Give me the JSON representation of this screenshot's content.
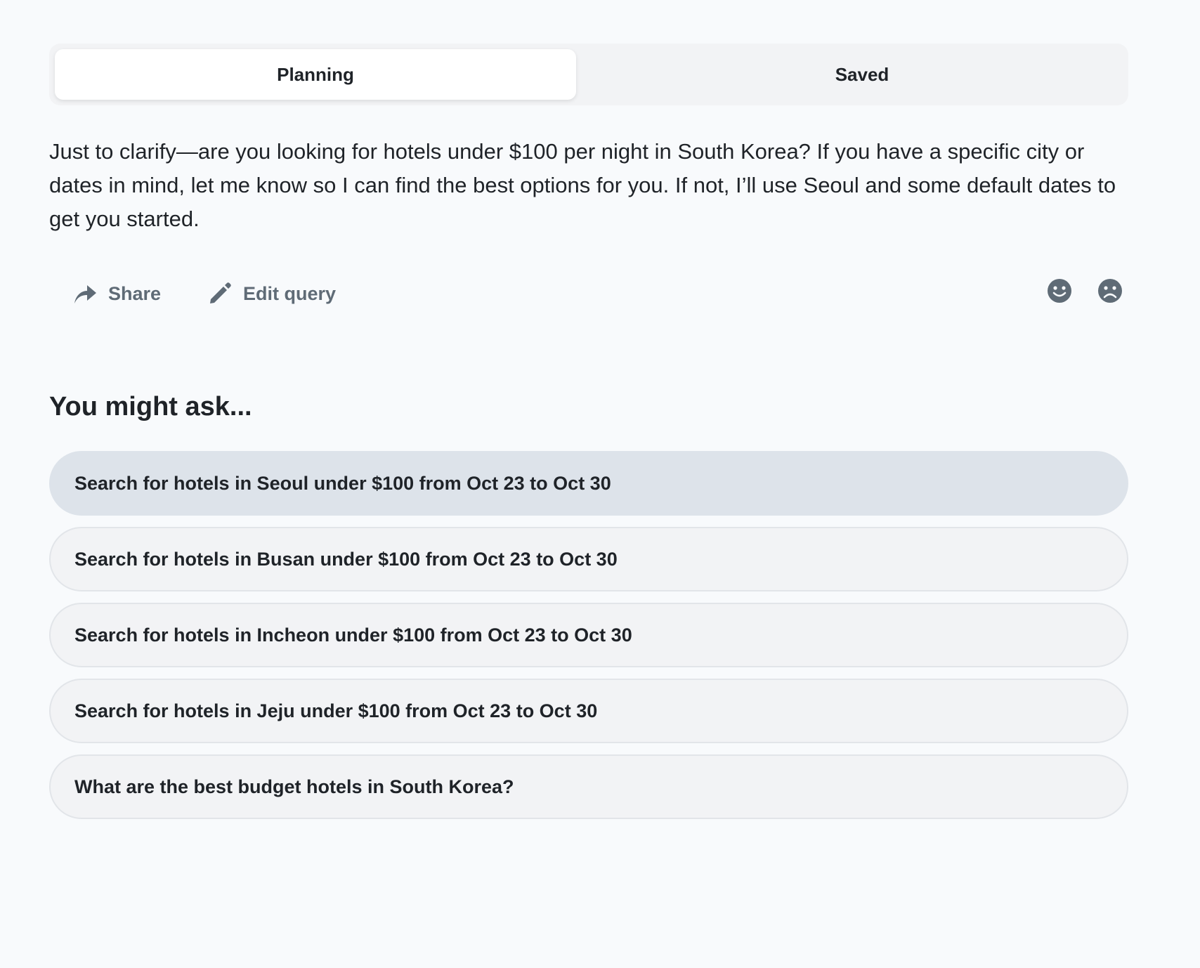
{
  "tabs": [
    {
      "label": "Planning",
      "active": true
    },
    {
      "label": "Saved",
      "active": false
    }
  ],
  "message": {
    "text": "Just to clarify—are you looking for hotels under $100 per night in South Korea? If you have a specific city or dates in mind, let me know so I can find the best options for you. If not, I’ll use Seoul and some default dates to get you started."
  },
  "actions": {
    "share_label": "Share",
    "edit_label": "Edit query",
    "share_icon": "share-arrow-icon",
    "edit_icon": "pencil-icon",
    "thumbs_up_icon": "smile-face-icon",
    "thumbs_down_icon": "frown-face-icon"
  },
  "suggestions": {
    "heading": "You might ask...",
    "items": [
      {
        "label": "Search for hotels in Seoul under $100 from Oct 23 to Oct 30",
        "highlighted": true
      },
      {
        "label": "Search for hotels in Busan under $100 from Oct 23 to Oct 30",
        "highlighted": false
      },
      {
        "label": "Search for hotels in Incheon under $100 from Oct 23 to Oct 30",
        "highlighted": false
      },
      {
        "label": "Search for hotels in Jeju under $100 from Oct 23 to Oct 30",
        "highlighted": false
      },
      {
        "label": "What are the best budget hotels in South Korea?",
        "highlighted": false
      }
    ]
  },
  "colors": {
    "background": "#f8fafc",
    "text": "#1f2328",
    "muted": "#5f6b76",
    "suggestion_bg": "#f2f3f5",
    "suggestion_highlight": "#dde3ea"
  }
}
